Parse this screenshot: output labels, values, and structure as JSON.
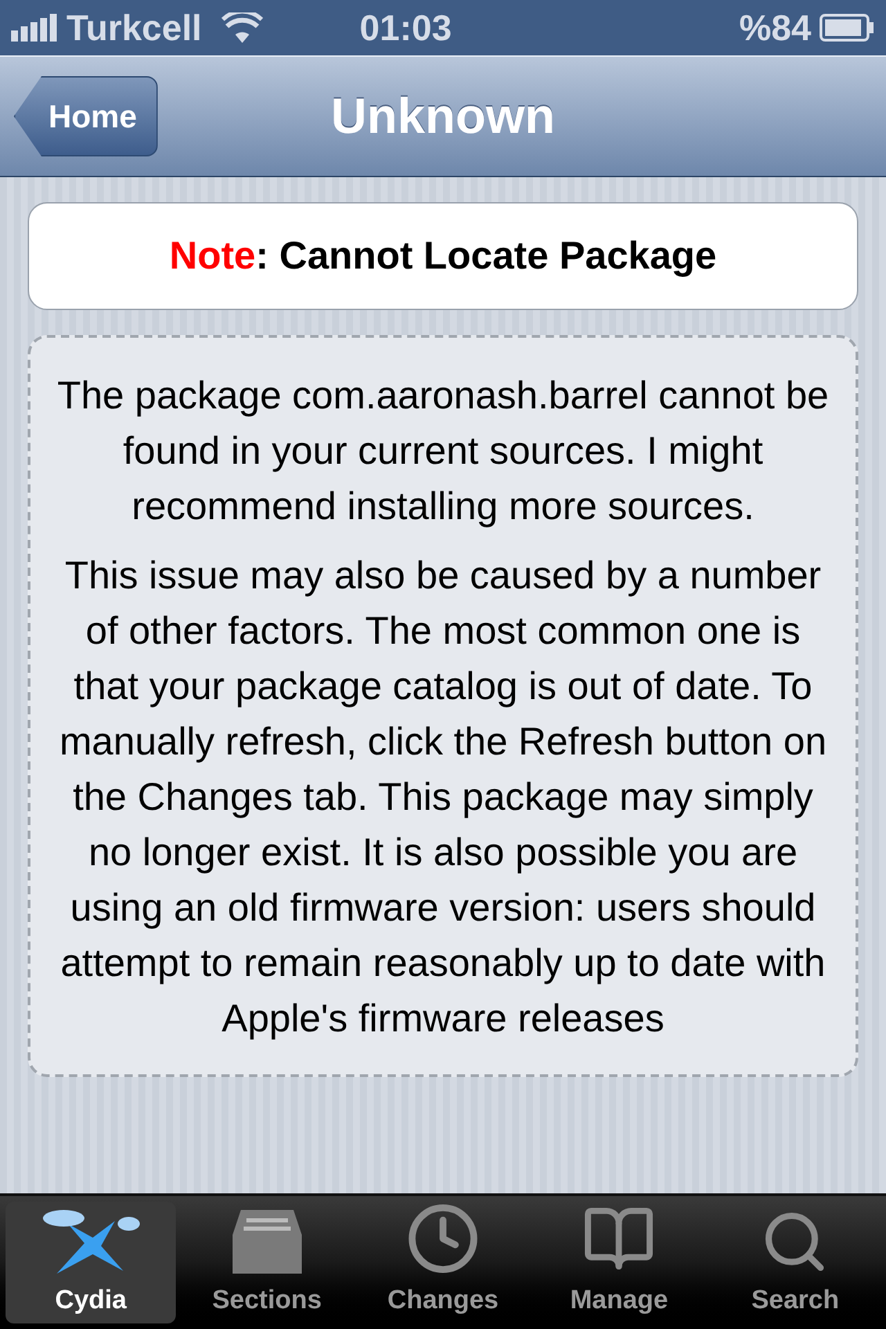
{
  "status_bar": {
    "carrier": "Turkcell",
    "time": "01:03",
    "battery": "%84"
  },
  "nav_bar": {
    "back": "Home",
    "title": "Unknown"
  },
  "note": {
    "label": "Note",
    "text": ": Cannot Locate Package"
  },
  "paragraphs": [
    "The package com.aaronash.barrel cannot be found in your current sources. I might recommend installing more sources.",
    "This issue may also be caused by a number of other factors. The most common one is that your package catalog is out of date. To manually refresh, click the Refresh button on the Changes tab. This package may simply no longer exist. It is also possible you are using an old firmware version: users should attempt to remain reasonably up to date with Apple's firmware releases"
  ],
  "tabs": [
    {
      "label": "Cydia",
      "kind": "cydia",
      "selected": true
    },
    {
      "label": "Sections",
      "kind": "sections",
      "selected": false
    },
    {
      "label": "Changes",
      "kind": "changes",
      "selected": false
    },
    {
      "label": "Manage",
      "kind": "manage",
      "selected": false
    },
    {
      "label": "Search",
      "kind": "search",
      "selected": false
    }
  ]
}
